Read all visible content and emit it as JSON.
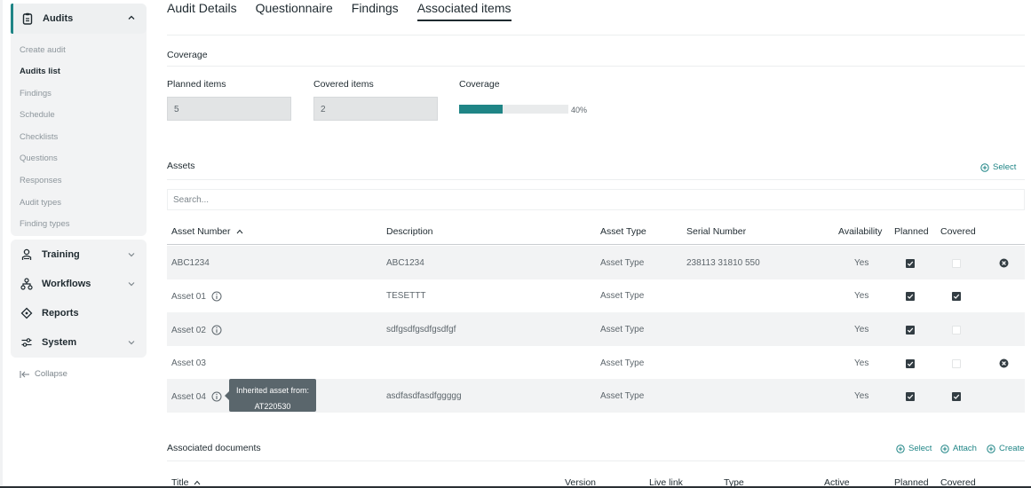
{
  "sidebar": {
    "audits_label": "Audits",
    "audits_sub": [
      "Create audit",
      "Audits list",
      "Findings",
      "Schedule",
      "Checklists",
      "Questions",
      "Responses",
      "Audit types",
      "Finding types"
    ],
    "active_sub": "Audits list",
    "groups": [
      {
        "label": "Training",
        "icon": "trainer-icon"
      },
      {
        "label": "Workflows",
        "icon": "workflow-icon"
      },
      {
        "label": "Reports",
        "icon": "diamond-icon"
      },
      {
        "label": "System",
        "icon": "sliders-icon"
      }
    ],
    "collapse_label": "Collapse",
    "accent": "#1f8586"
  },
  "tabs": [
    "Audit Details",
    "Questionnaire",
    "Findings",
    "Associated items"
  ],
  "active_tab": "Associated items",
  "coverage": {
    "section_title": "Coverage",
    "planned_label": "Planned items",
    "planned_value": "5",
    "covered_label": "Covered items",
    "covered_value": "2",
    "coverage_label": "Coverage",
    "coverage_percent": 40,
    "coverage_text": "40%"
  },
  "assets": {
    "section_title": "Assets",
    "select_label": "Select",
    "search_placeholder": "Search...",
    "columns": [
      "Asset Number",
      "Description",
      "Asset Type",
      "Serial Number",
      "Availability",
      "Planned",
      "Covered"
    ],
    "rows": [
      {
        "number": "ABC1234",
        "description": "ABC1234",
        "type": "Asset Type",
        "serial": "238113 31810 550",
        "availability": "Yes",
        "planned": true,
        "covered": false,
        "info": false,
        "removable": true
      },
      {
        "number": "Asset 01",
        "description": "TESETTT",
        "type": "Asset Type",
        "serial": "",
        "availability": "Yes",
        "planned": true,
        "covered": true,
        "info": true,
        "removable": false
      },
      {
        "number": "Asset 02",
        "description": "sdfgsdfgsdfgsdfgf",
        "type": "Asset Type",
        "serial": "",
        "availability": "Yes",
        "planned": true,
        "covered": false,
        "info": true,
        "removable": false
      },
      {
        "number": "Asset 03",
        "description": "",
        "type": "Asset Type",
        "serial": "",
        "availability": "Yes",
        "planned": true,
        "covered": false,
        "info": false,
        "removable": true
      },
      {
        "number": "Asset 04",
        "description": "asdfasdfasdfggggg",
        "type": "Asset Type",
        "serial": "",
        "availability": "Yes",
        "planned": true,
        "covered": true,
        "info": true,
        "removable": false
      }
    ],
    "tooltip": {
      "line1": "Inherited asset from:",
      "line2": "AT220530"
    }
  },
  "documents": {
    "section_title": "Associated documents",
    "actions": [
      "Select",
      "Attach",
      "Create"
    ],
    "columns": [
      "Title",
      "Version",
      "Live link",
      "Type",
      "Active",
      "Planned",
      "Covered"
    ]
  }
}
